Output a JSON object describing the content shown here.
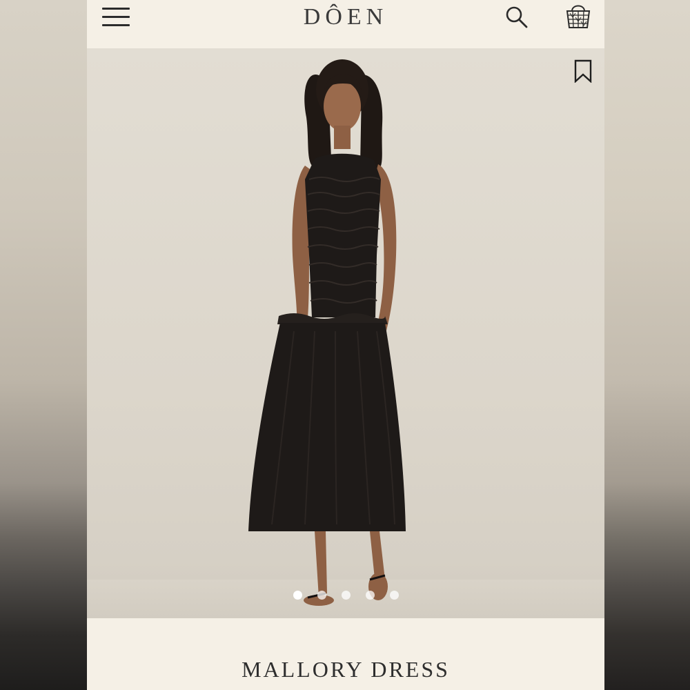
{
  "header": {
    "brand": "DÔEN",
    "icons": {
      "menu": "hamburger-menu-icon",
      "search": "search-icon",
      "bag": "shopping-basket-icon"
    }
  },
  "gallery": {
    "bookmark_icon": "bookmark-icon",
    "slide_count": 5,
    "active_slide": 1
  },
  "product": {
    "name": "MALLORY DRESS"
  },
  "colors": {
    "background": "#f5f0e6",
    "text": "#2e2e2e",
    "dress": "#1e1a18"
  }
}
